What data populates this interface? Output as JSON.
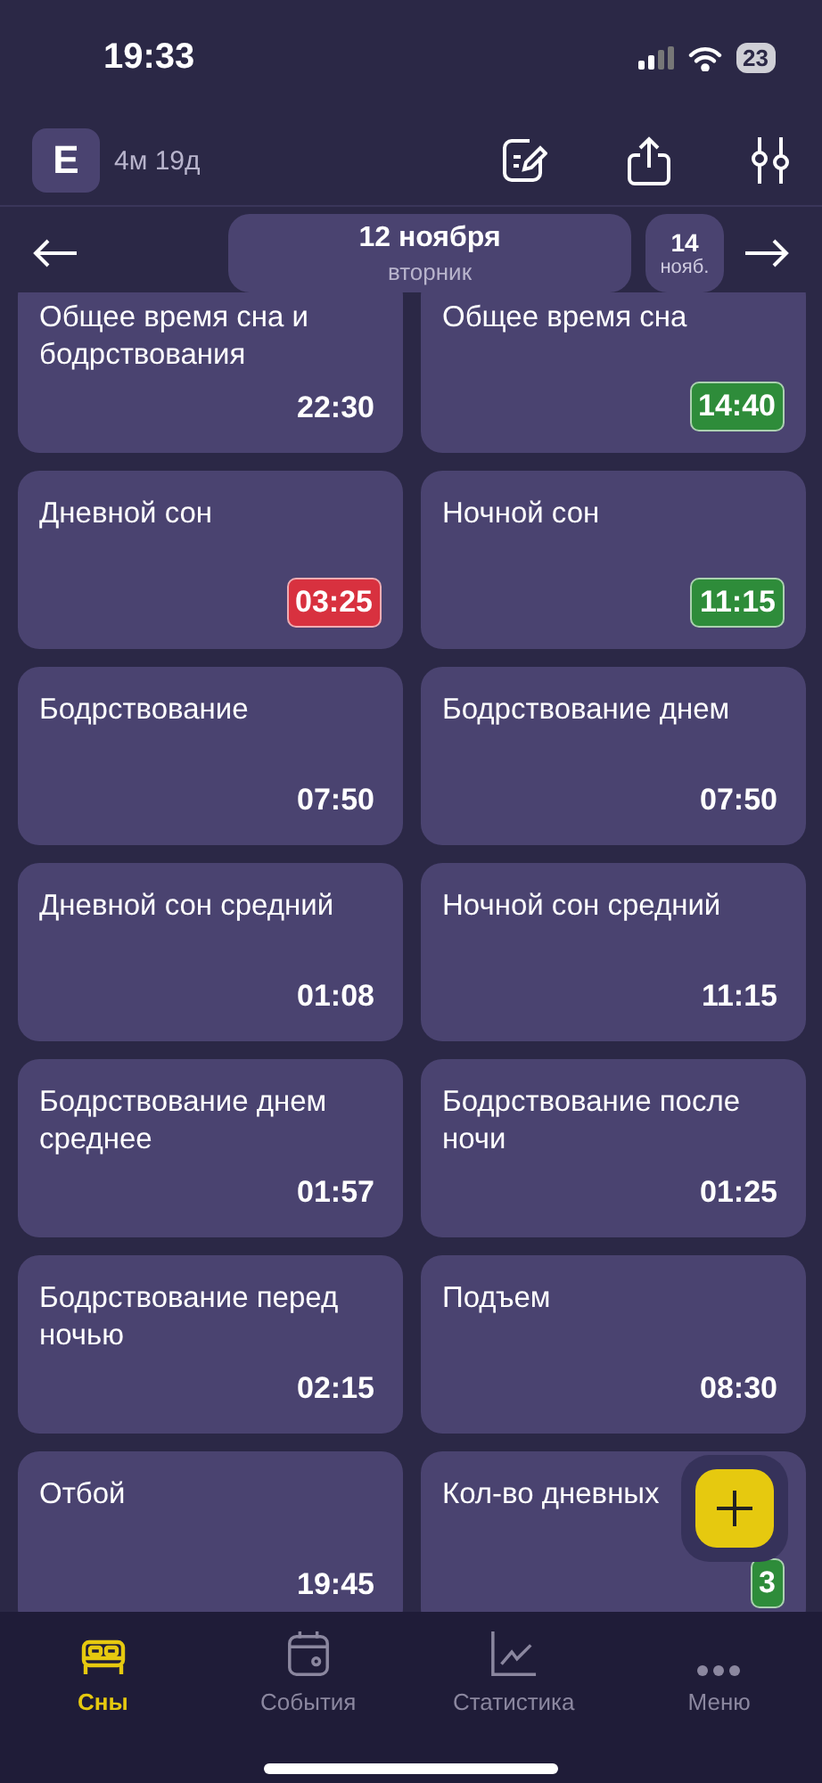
{
  "status_bar": {
    "time": "19:33",
    "battery": "23"
  },
  "header": {
    "avatar": "E",
    "age": "4м 19д"
  },
  "date_nav": {
    "current_date": "12 ноября",
    "current_weekday": "вторник",
    "next_day": "14",
    "next_month": "нояб."
  },
  "cards": [
    {
      "title": "Общее время сна и бодрствования",
      "value": "22:30"
    },
    {
      "title": "Общее время сна",
      "value": "14:40",
      "color": "#2e8c3a"
    },
    {
      "title": "Дневной сон",
      "value": "03:25",
      "color": "#d8313f"
    },
    {
      "title": "Ночной сон",
      "value": "11:15",
      "color": "#2e8c3a"
    },
    {
      "title": "Бодрствование",
      "value": "07:50"
    },
    {
      "title": "Бодрствование днем",
      "value": "07:50"
    },
    {
      "title": "Дневной сон средний",
      "value": "01:08"
    },
    {
      "title": "Ночной сон средний",
      "value": "11:15"
    },
    {
      "title": "Бодрствование днем среднее",
      "value": "01:57"
    },
    {
      "title": "Бодрствование после ночи",
      "value": "01:25"
    },
    {
      "title": "Бодрствование перед ночью",
      "value": "02:15"
    },
    {
      "title": "Подъем",
      "value": "08:30"
    },
    {
      "title": "Отбой",
      "value": "19:45"
    },
    {
      "title": "Кол-во дневных",
      "value": "3",
      "color": "#2e8c3a"
    }
  ],
  "tabs": [
    {
      "label": "Сны",
      "kind": "bed",
      "selected": true
    },
    {
      "label": "События",
      "kind": "calendar",
      "selected": false
    },
    {
      "label": "Статистика",
      "kind": "chart",
      "selected": false
    },
    {
      "label": "Меню",
      "kind": "dots",
      "selected": false
    }
  ]
}
